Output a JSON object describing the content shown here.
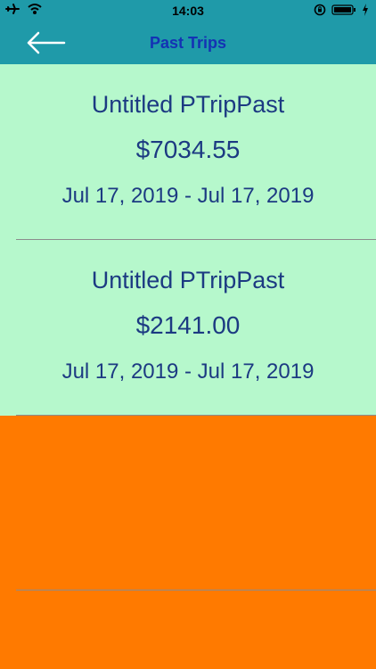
{
  "status_bar": {
    "time": "14:03",
    "icons": [
      "airplane-icon",
      "wifi-icon",
      "rotation-lock-icon",
      "battery-icon",
      "charging-icon"
    ]
  },
  "nav": {
    "title": "Past Trips",
    "back_icon": "arrow-left-icon"
  },
  "trips": [
    {
      "name": "Untitled PTripPast",
      "amount": "$7034.55",
      "dates": "Jul 17, 2019 - Jul 17, 2019"
    },
    {
      "name": "Untitled PTripPast",
      "amount": "$2141.00",
      "dates": "Jul 17, 2019 - Jul 17, 2019"
    }
  ],
  "colors": {
    "header": "#1f9aa9",
    "row_background": "#b6f8cc",
    "empty_background": "#ff7a00",
    "title_text": "#1432b4",
    "row_text": "#1c3a82"
  }
}
